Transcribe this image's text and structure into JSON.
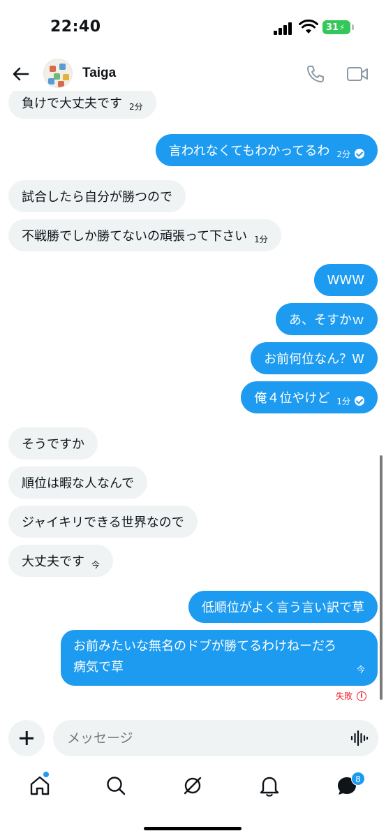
{
  "status_bar": {
    "time": "22:40",
    "battery": "31"
  },
  "header": {
    "contact_name": "Taiga"
  },
  "messages": [
    {
      "side": "received",
      "text": "負けで大丈夫です",
      "time": "2分"
    },
    {
      "side": "sent",
      "text": "言われなくてもわかってるわ",
      "time": "2分",
      "read": true
    },
    {
      "side": "received",
      "text": "試合したら自分が勝つので"
    },
    {
      "side": "received",
      "text": "不戦勝でしか勝てないの頑張って下さい",
      "time": "1分"
    },
    {
      "side": "sent",
      "text": "WWW"
    },
    {
      "side": "sent",
      "text": "あ、そすかｗ"
    },
    {
      "side": "sent",
      "text": "お前何位なん？W"
    },
    {
      "side": "sent",
      "text": "俺４位やけど",
      "time": "1分",
      "read": true
    },
    {
      "side": "received",
      "text": "そうですか"
    },
    {
      "side": "received",
      "text": "順位は暇な人なんで"
    },
    {
      "side": "received",
      "text": "ジャイキリできる世界なので"
    },
    {
      "side": "received",
      "text": "大丈夫です",
      "time": "今"
    },
    {
      "side": "sent",
      "text": "低順位がよく言う言い訳で草"
    },
    {
      "side": "sent",
      "text_line1": "お前みたいな無名のドブが勝てるわけねーだろ",
      "text_line2": "病気で草",
      "time": "今"
    }
  ],
  "failed_status": "失敗",
  "composer": {
    "placeholder": "メッセージ"
  },
  "tab_bar": {
    "messages_badge": "8"
  },
  "colors": {
    "accent": "#1d9bf0",
    "received_bubble": "#eff3f4",
    "error": "#f4212e"
  }
}
